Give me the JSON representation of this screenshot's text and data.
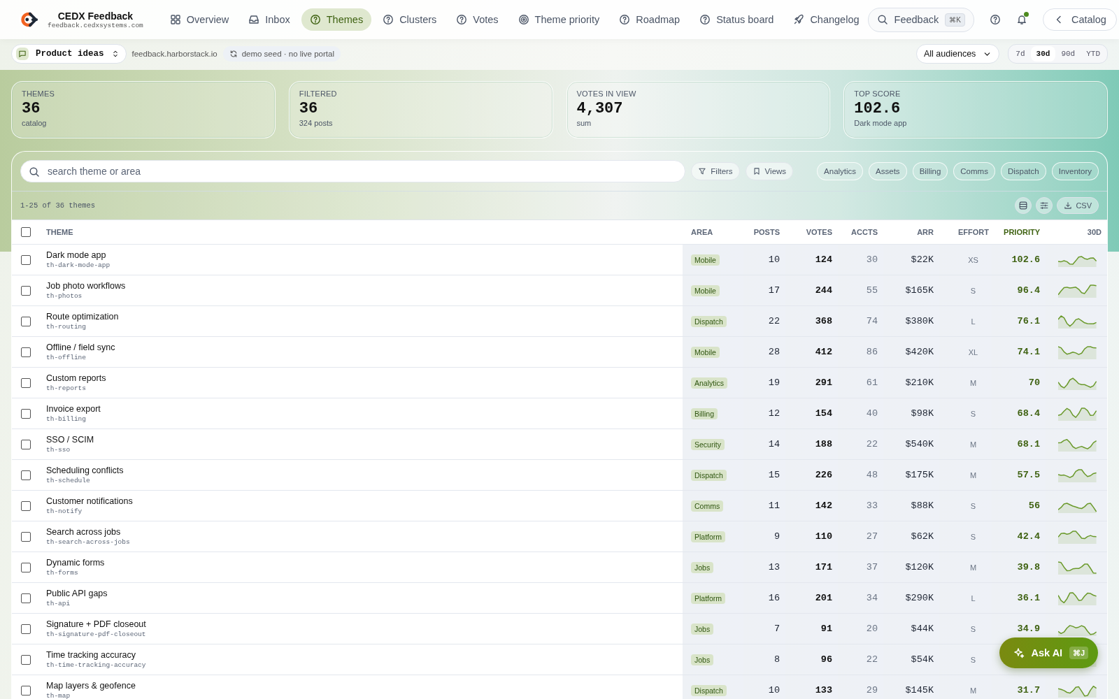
{
  "brand": {
    "name": "CEDX Feedback",
    "domain": "feedback.cedxsystems.com"
  },
  "nav": [
    {
      "label": "Overview",
      "selected": false
    },
    {
      "label": "Inbox",
      "selected": false
    },
    {
      "label": "Themes",
      "selected": true
    },
    {
      "label": "Clusters",
      "selected": false
    },
    {
      "label": "Votes",
      "selected": false
    },
    {
      "label": "Theme priority",
      "selected": false
    },
    {
      "label": "Roadmap",
      "selected": false
    },
    {
      "label": "Status board",
      "selected": false
    },
    {
      "label": "Changelog",
      "selected": false
    }
  ],
  "search": {
    "label": "Feedback",
    "shortcut": "⌘K"
  },
  "notifications": {
    "unread": true
  },
  "back_button": "Catalog",
  "workspace": {
    "label": "Product ideas",
    "domain": "feedback.harborstack.io",
    "status": "demo seed · no live portal"
  },
  "audience": "All audiences",
  "ranges": [
    {
      "label": "7d",
      "selected": false
    },
    {
      "label": "30d",
      "selected": true
    },
    {
      "label": "90d",
      "selected": false
    },
    {
      "label": "YTD",
      "selected": false
    }
  ],
  "stats": [
    {
      "label": "THEMES",
      "value": "36",
      "sub": "catalog"
    },
    {
      "label": "FILTERED",
      "value": "36",
      "sub": "324 posts"
    },
    {
      "label": "VOTES IN VIEW",
      "value": "4,307",
      "sub": "sum"
    },
    {
      "label": "TOP SCORE",
      "value": "102.6",
      "sub": "Dark mode app"
    }
  ],
  "toolbar": {
    "placeholder": "search theme or area",
    "filters": "Filters",
    "views": "Views",
    "chips": [
      "Analytics",
      "Assets",
      "Billing",
      "Comms",
      "Dispatch",
      "Inventory"
    ]
  },
  "count": "1-25 of 36 themes",
  "csv": "CSV",
  "table": {
    "select_all_checked": false,
    "columns": [
      "THEME",
      "AREA",
      "POSTS",
      "VOTES",
      "ACCTS",
      "ARR",
      "EFFORT",
      "PRIORITY",
      "30D"
    ],
    "rows": [
      {
        "checked": false,
        "theme": "Dark mode app",
        "slug": "th-dark-mode-app",
        "area": "Mobile",
        "posts": "10",
        "votes": "124",
        "accts": "30",
        "arr": "$22K",
        "effort": "XS",
        "priority": "102.6"
      },
      {
        "checked": false,
        "theme": "Job photo workflows",
        "slug": "th-photos",
        "area": "Mobile",
        "posts": "17",
        "votes": "244",
        "accts": "55",
        "arr": "$165K",
        "effort": "S",
        "priority": "96.4"
      },
      {
        "checked": false,
        "theme": "Route optimization",
        "slug": "th-routing",
        "area": "Dispatch",
        "posts": "22",
        "votes": "368",
        "accts": "74",
        "arr": "$380K",
        "effort": "L",
        "priority": "76.1"
      },
      {
        "checked": false,
        "theme": "Offline / field sync",
        "slug": "th-offline",
        "area": "Mobile",
        "posts": "28",
        "votes": "412",
        "accts": "86",
        "arr": "$420K",
        "effort": "XL",
        "priority": "74.1"
      },
      {
        "checked": false,
        "theme": "Custom reports",
        "slug": "th-reports",
        "area": "Analytics",
        "posts": "19",
        "votes": "291",
        "accts": "61",
        "arr": "$210K",
        "effort": "M",
        "priority": "70"
      },
      {
        "checked": false,
        "theme": "Invoice export",
        "slug": "th-billing",
        "area": "Billing",
        "posts": "12",
        "votes": "154",
        "accts": "40",
        "arr": "$98K",
        "effort": "S",
        "priority": "68.4"
      },
      {
        "checked": false,
        "theme": "SSO / SCIM",
        "slug": "th-sso",
        "area": "Security",
        "posts": "14",
        "votes": "188",
        "accts": "22",
        "arr": "$540K",
        "effort": "M",
        "priority": "68.1"
      },
      {
        "checked": false,
        "theme": "Scheduling conflicts",
        "slug": "th-schedule",
        "area": "Dispatch",
        "posts": "15",
        "votes": "226",
        "accts": "48",
        "arr": "$175K",
        "effort": "M",
        "priority": "57.5"
      },
      {
        "checked": false,
        "theme": "Customer notifications",
        "slug": "th-notify",
        "area": "Comms",
        "posts": "11",
        "votes": "142",
        "accts": "33",
        "arr": "$88K",
        "effort": "S",
        "priority": "56"
      },
      {
        "checked": false,
        "theme": "Search across jobs",
        "slug": "th-search-across-jobs",
        "area": "Platform",
        "posts": "9",
        "votes": "110",
        "accts": "27",
        "arr": "$62K",
        "effort": "S",
        "priority": "42.4"
      },
      {
        "checked": false,
        "theme": "Dynamic forms",
        "slug": "th-forms",
        "area": "Jobs",
        "posts": "13",
        "votes": "171",
        "accts": "37",
        "arr": "$120K",
        "effort": "M",
        "priority": "39.8"
      },
      {
        "checked": false,
        "theme": "Public API gaps",
        "slug": "th-api",
        "area": "Platform",
        "posts": "16",
        "votes": "201",
        "accts": "34",
        "arr": "$290K",
        "effort": "L",
        "priority": "36.1"
      },
      {
        "checked": false,
        "theme": "Signature + PDF closeout",
        "slug": "th-signature-pdf-closeout",
        "area": "Jobs",
        "posts": "7",
        "votes": "91",
        "accts": "20",
        "arr": "$44K",
        "effort": "S",
        "priority": "34.9"
      },
      {
        "checked": false,
        "theme": "Time tracking accuracy",
        "slug": "th-time-tracking-accuracy",
        "area": "Jobs",
        "posts": "8",
        "votes": "96",
        "accts": "22",
        "arr": "$54K",
        "effort": "S"
      },
      {
        "checked": false,
        "theme": "Map layers & geofence",
        "slug": "th-map",
        "area": "Dispatch",
        "posts": "10",
        "votes": "133",
        "accts": "29",
        "arr": "$145K",
        "effort": "M",
        "priority": "31.7"
      }
    ]
  },
  "ask_ai": {
    "label": "Ask AI",
    "shortcut": "⌘J"
  }
}
